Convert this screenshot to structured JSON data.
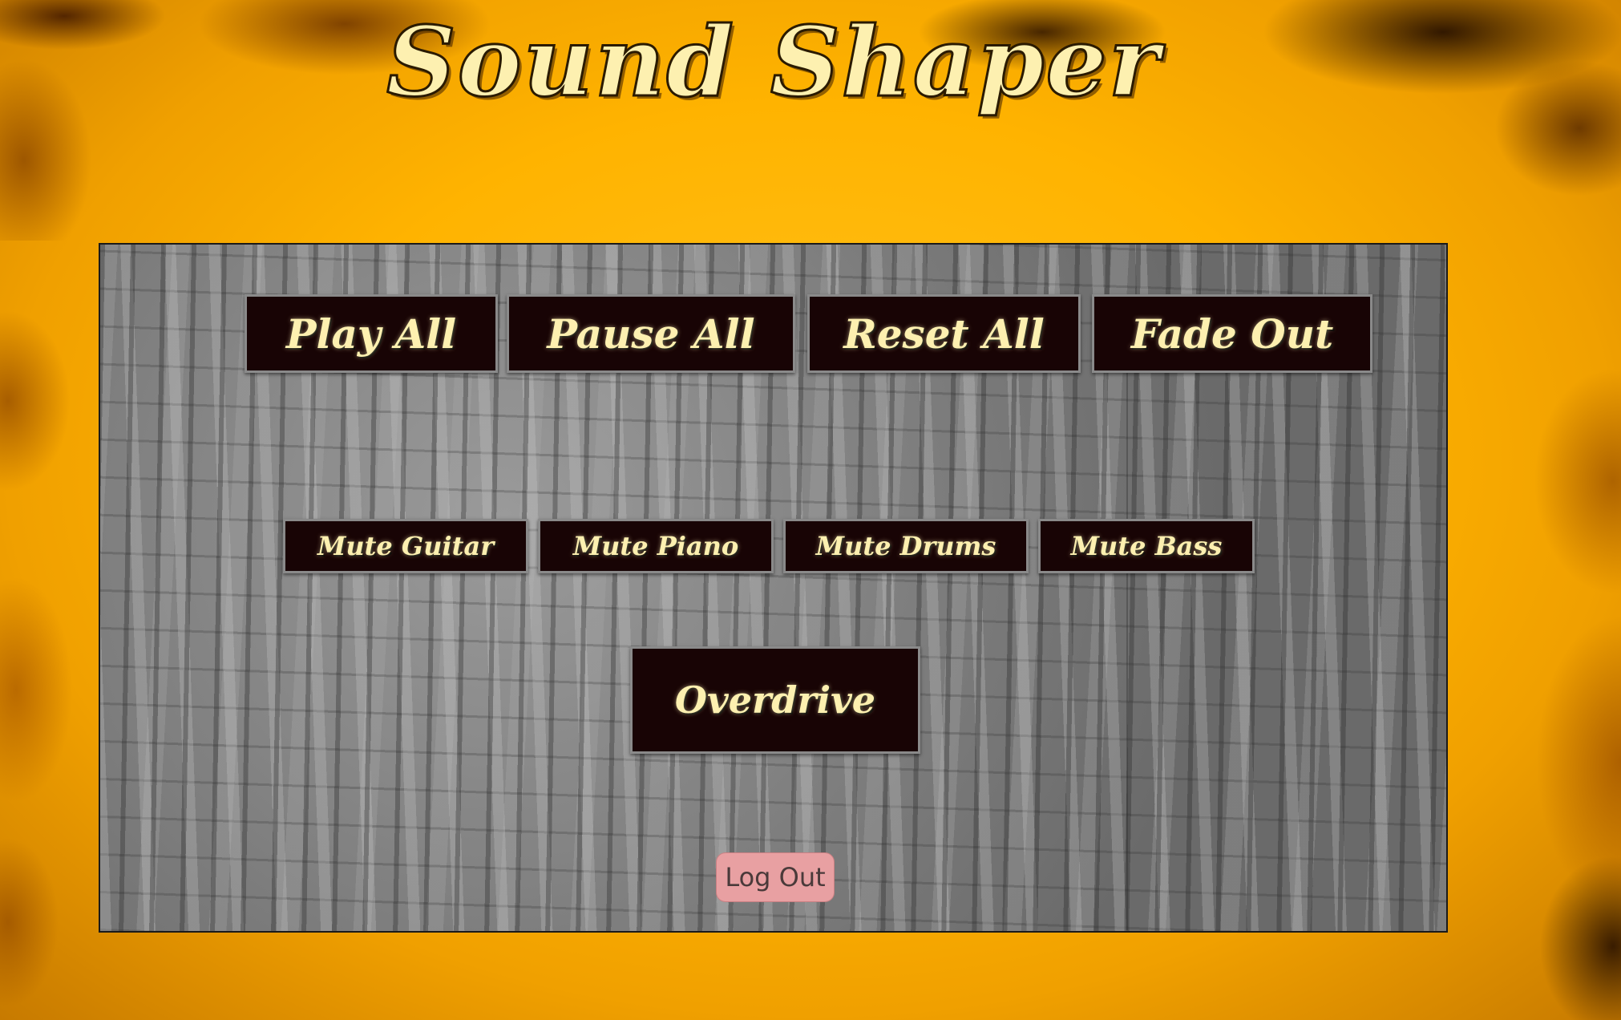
{
  "header": {
    "title": "Sound Shaper"
  },
  "controls": {
    "play_all": "Play All",
    "pause_all": "Pause All",
    "reset_all": "Reset All",
    "fade_out": "Fade Out"
  },
  "mutes": {
    "guitar": "Mute Guitar",
    "piano": "Mute Piano",
    "drums": "Mute Drums",
    "bass": "Mute Bass"
  },
  "effects": {
    "overdrive": "Overdrive"
  },
  "account": {
    "logout": "Log Out"
  },
  "colors": {
    "background": "#ffb300",
    "button_bg": "#180405",
    "button_text": "#fdf0b0",
    "logout_bg": "#e8a0a2"
  }
}
